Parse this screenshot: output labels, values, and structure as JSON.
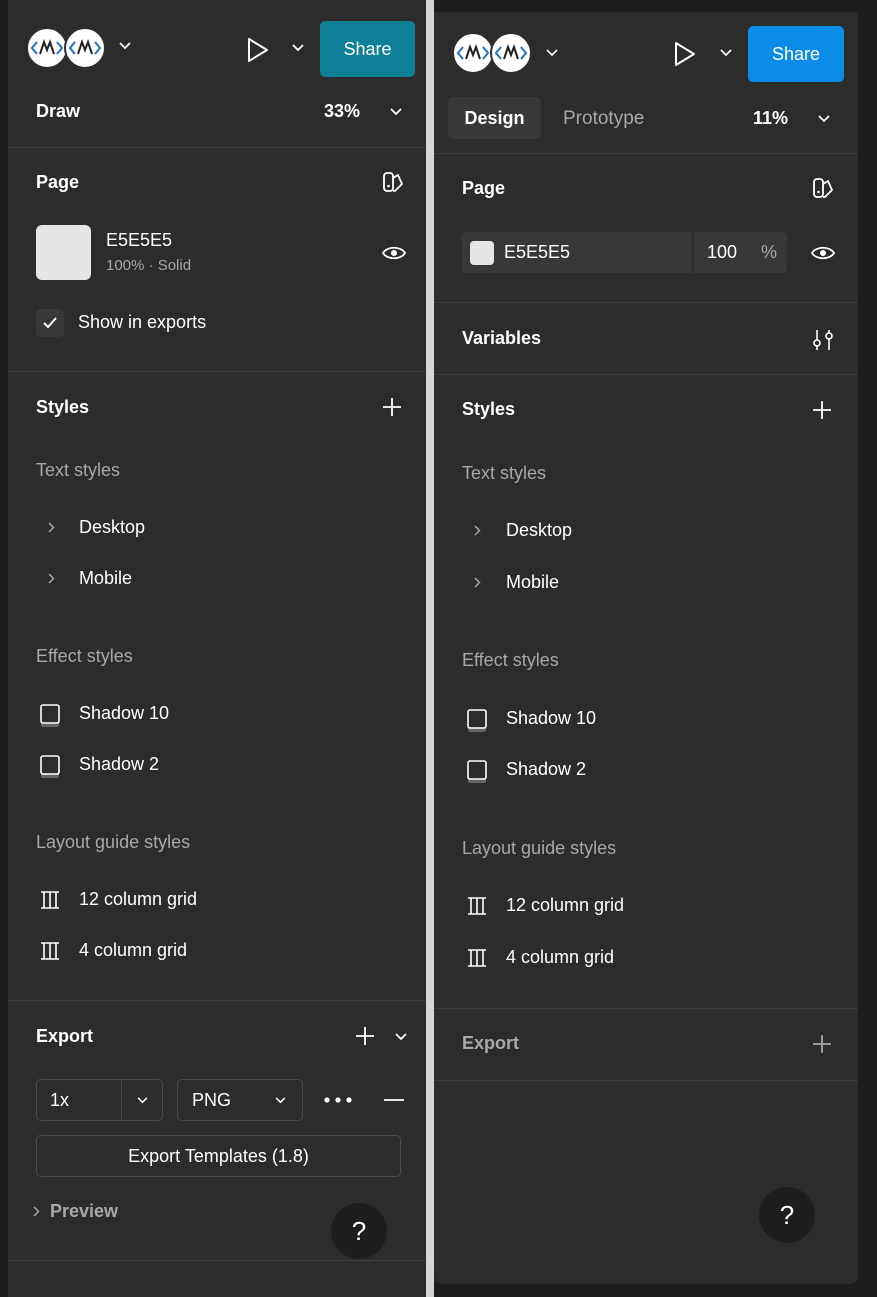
{
  "left_panel": {
    "share_label": "Share",
    "share_color": "#0d7f96",
    "mode_label": "Draw",
    "zoom": "33%",
    "page": {
      "title": "Page",
      "color_hex": "E5E5E5",
      "color_sub": "100% · Solid",
      "show_in_exports": "Show in exports"
    },
    "styles": {
      "title": "Styles",
      "text_styles_title": "Text styles",
      "text_styles": [
        "Desktop",
        "Mobile"
      ],
      "effect_styles_title": "Effect styles",
      "effect_styles": [
        "Shadow 10",
        "Shadow 2"
      ],
      "layout_styles_title": "Layout guide styles",
      "layout_styles": [
        "12 column grid",
        "4 column grid"
      ]
    },
    "export": {
      "title": "Export",
      "scale": "1x",
      "format": "PNG",
      "templates_button": "Export Templates (1.8)",
      "preview": "Preview"
    },
    "help": "?"
  },
  "right_panel": {
    "share_label": "Share",
    "share_color": "#0c8ce9",
    "tabs": [
      "Design",
      "Prototype"
    ],
    "zoom": "11%",
    "page": {
      "title": "Page",
      "color_hex": "E5E5E5",
      "opacity": "100",
      "percent": "%"
    },
    "variables_title": "Variables",
    "styles": {
      "title": "Styles",
      "text_styles_title": "Text styles",
      "text_styles": [
        "Desktop",
        "Mobile"
      ],
      "effect_styles_title": "Effect styles",
      "effect_styles": [
        "Shadow 10",
        "Shadow 2"
      ],
      "layout_styles_title": "Layout guide styles",
      "layout_styles": [
        "12 column grid",
        "4 column grid"
      ]
    },
    "export_title": "Export",
    "help": "?"
  }
}
